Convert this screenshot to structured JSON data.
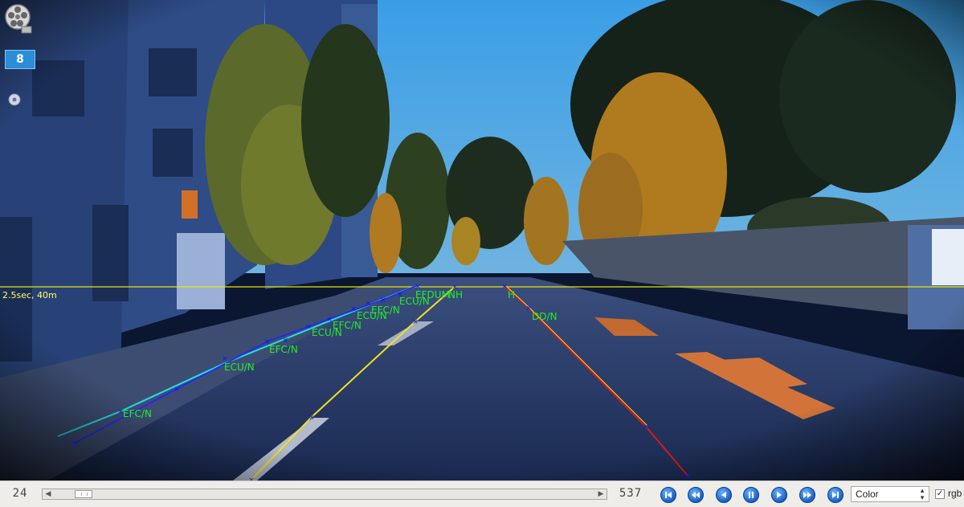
{
  "overlay": {
    "camera_badge": "8",
    "horizon_label": "2.5sec, 40m",
    "lane_labels": [
      "EFC/N",
      "ECU/N",
      "EFC/N",
      "ECU/N",
      "EFC/N",
      "ECU/N",
      "EFC/N",
      "ECU/N",
      "EFDUM",
      "NH",
      "H",
      "DD/N"
    ]
  },
  "controls": {
    "frame_current": "24",
    "frame_total": "537",
    "playback_buttons": [
      "first-frame",
      "rewind",
      "step-back",
      "pause",
      "step-forward",
      "fast-forward",
      "last-frame"
    ],
    "color_mode": "Color",
    "rgb_checked": true,
    "rgb_label": "rgb"
  },
  "colors": {
    "horizon_line": "#e6e600",
    "left_lane_inner": "#2222ff",
    "left_lane_outer": "#22e0e0",
    "center_lane": "#f0e020",
    "right_lane": "#e01818",
    "label_color": "#22ee22",
    "marker_color": "#1010ff"
  }
}
